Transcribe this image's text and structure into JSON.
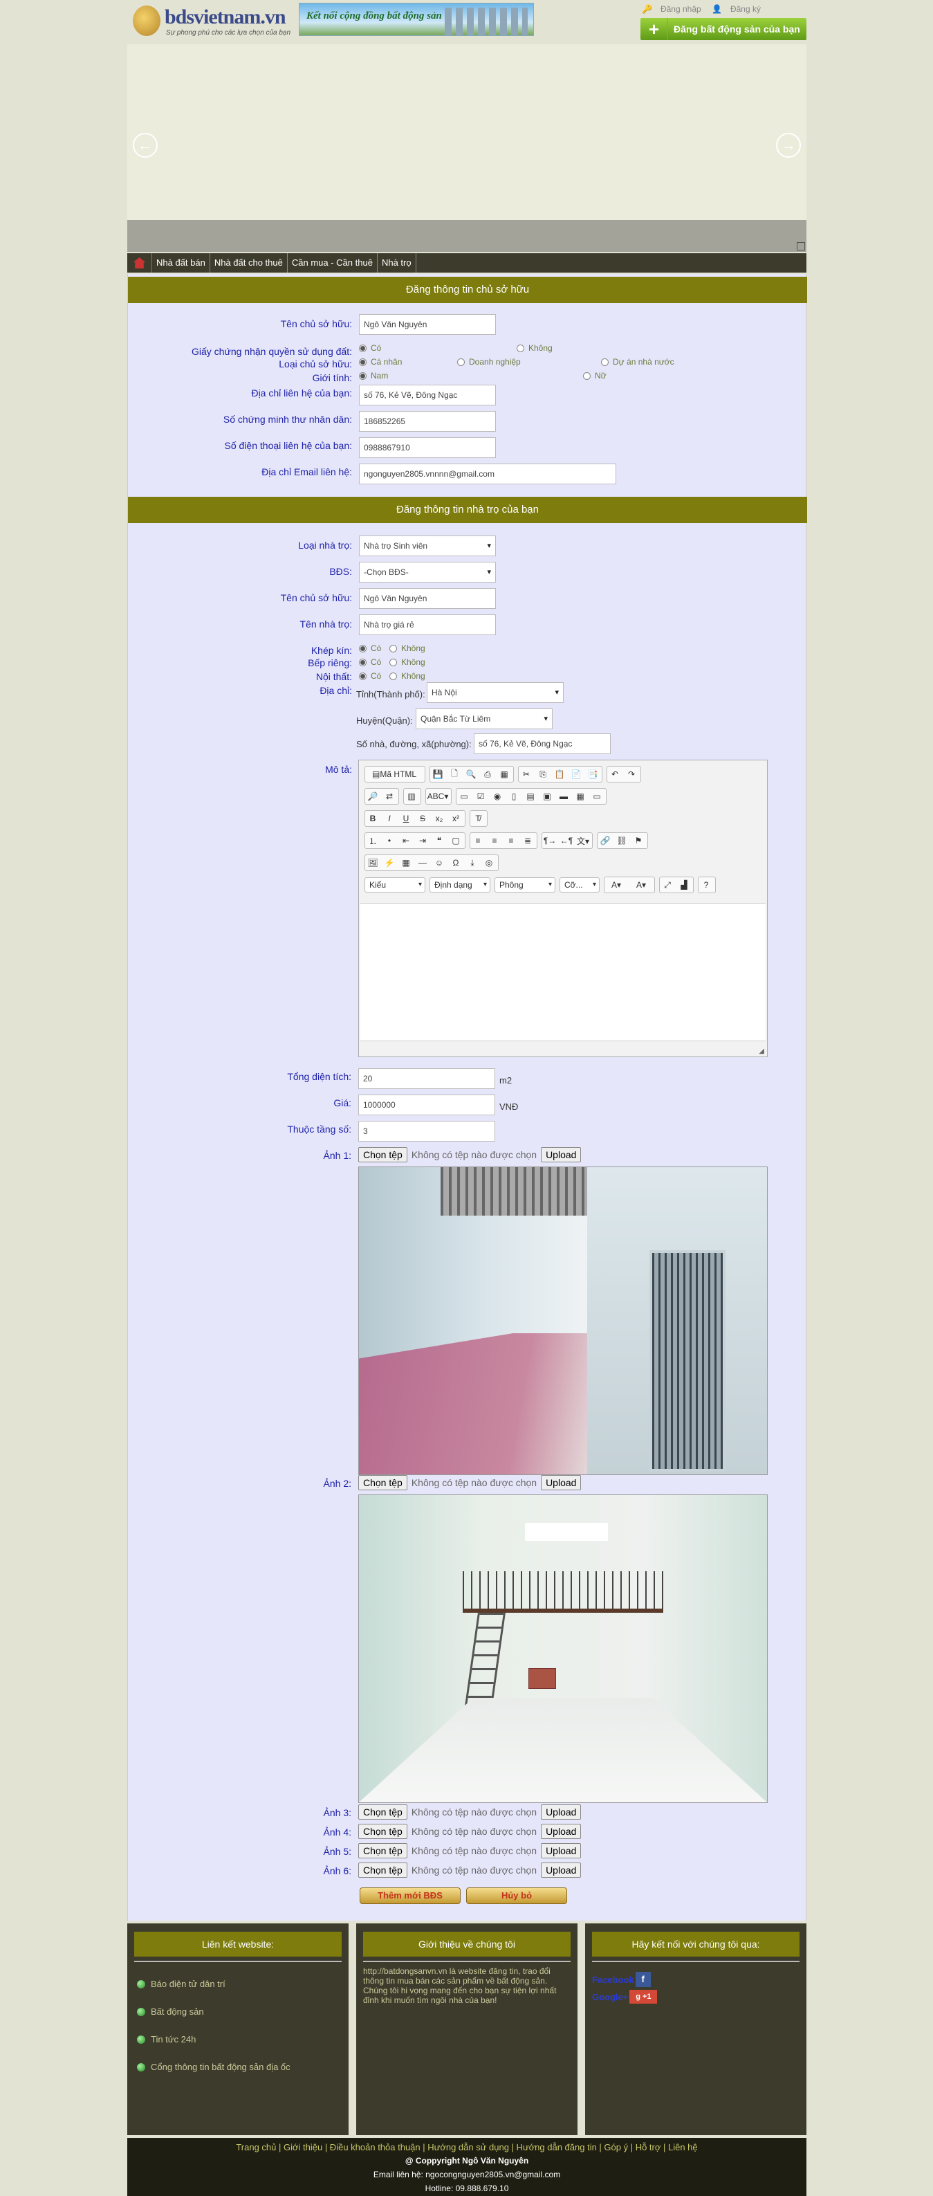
{
  "header": {
    "logo_name": "bdsvietnam.vn",
    "logo_slogan": "Sự phong phú cho các lựa chọn của bạn",
    "banner_text": "Kết nối cộng đồng bất động sản",
    "login": "Đăng nhập",
    "register": "Đăng ký",
    "post_button": "Đăng bất động sản của bạn"
  },
  "nav": [
    "Nhà đất bán",
    "Nhà đất cho thuê",
    "Cần mua - Cần thuê",
    "Nhà trọ"
  ],
  "owner": {
    "heading": "Đăng thông tin chủ sở hữu",
    "name_label": "Tên chủ sở hữu:",
    "name_value": "Ngô Văn Nguyên",
    "cert_label": "Giấy chứng nhận quyền sử dụng đất:",
    "cert_yes": "Có",
    "cert_no": "Không",
    "type_label": "Loại chủ sở hữu:",
    "type_personal": "Cá nhân",
    "type_business": "Doanh nghiệp",
    "type_state": "Dự án nhà nước",
    "gender_label": "Giới tính:",
    "gender_male": "Nam",
    "gender_female": "Nữ",
    "address_label": "Địa chỉ liên hệ của bạn:",
    "address_value": "số 76, Kẻ Vẽ, Đông Ngạc",
    "idcard_label": "Số chứng minh thư nhân dân:",
    "idcard_value": "186852265",
    "phone_label": "Số điện thoại liên hệ của bạn:",
    "phone_value": "0988867910",
    "email_label": "Địa chỉ Email liên hệ:",
    "email_value": "ngonguyen2805.vnnnn@gmail.com"
  },
  "room": {
    "heading": "Đăng thông tin nhà trọ của bạn",
    "type_label": "Loại nhà trọ:",
    "type_value": "Nhà trọ Sinh viên",
    "bds_label": "BĐS:",
    "bds_value": "-Chọn BĐS-",
    "owner_label": "Tên chủ sở hữu:",
    "owner_value": "Ngô Văn Nguyên",
    "name_label": "Tên nhà trọ:",
    "name_value": "Nhà trọ giá rẻ",
    "closed_label": "Khép kín:",
    "kitchen_label": "Bếp riêng:",
    "furniture_label": "Nội thất:",
    "yes": "Có",
    "no": "Không",
    "location_label": "Địa chỉ:",
    "province_label": "Tỉnh(Thành phố):",
    "province_value": "Hà Nội",
    "district_label": "Huyện(Quận):",
    "district_value": "Quận Bắc Từ Liêm",
    "street_label": "Số nhà, đường, xã(phường):",
    "street_value": "số 76, Kẻ Vẽ, Đông Ngạc",
    "desc_label": "Mô tả:",
    "area_label": "Tổng diện tích:",
    "area_value": "20",
    "area_unit": "m2",
    "price_label": "Giá:",
    "price_value": "1000000",
    "price_unit": "VNĐ",
    "floor_label": "Thuộc tầng số:",
    "floor_value": "3"
  },
  "editor": {
    "source": "Mã HTML",
    "style": "Kiểu",
    "format": "Định dạng",
    "font": "Phông",
    "size": "Cỡ..."
  },
  "photos": {
    "labels": [
      "Ảnh 1:",
      "Ảnh 2:",
      "Ảnh 3:",
      "Ảnh 4:",
      "Ảnh 5:",
      "Ảnh 6:"
    ],
    "choose": "Chọn tệp",
    "no_file": "Không có tệp nào được chọn",
    "upload": "Upload"
  },
  "actions": {
    "add": "Thêm mới BĐS",
    "cancel": "Hủy bỏ"
  },
  "footer": {
    "col1_title": "Liên kết website:",
    "col1_links": [
      "Báo điện tử dân trí",
      "Bất động sản",
      "Tin tức 24h",
      "Cổng thông tin bất động sản địa ốc"
    ],
    "col2_title": "Giới thiệu về chúng tôi",
    "col2_text": "http://batdongsanvn.vn là website đăng tin, trao đổi thông tin mua bán các sản phẩm về bất động sản. Chúng tôi hi vọng mang đến cho bạn sự tiện lợi nhất đỉnh khi muốn tìm ngôi nhà của bạn!",
    "col3_title": "Hãy kết nối với chúng tôi qua:",
    "facebook": "Facebook",
    "google": "Google+",
    "links": "Trang chủ | Giới thiệu | Điều khoản thỏa thuận | Hướng dẫn sử dụng | Hướng dẫn đăng tin | Góp ý | Hỗ trợ | Liên hệ",
    "copyright": "@ Coppyright Ngô Văn Nguyên",
    "email": "Email liên hệ: ngocongnguyen2805.vn@gmail.com",
    "hotline": "Hotline: 09.888.679.10"
  }
}
